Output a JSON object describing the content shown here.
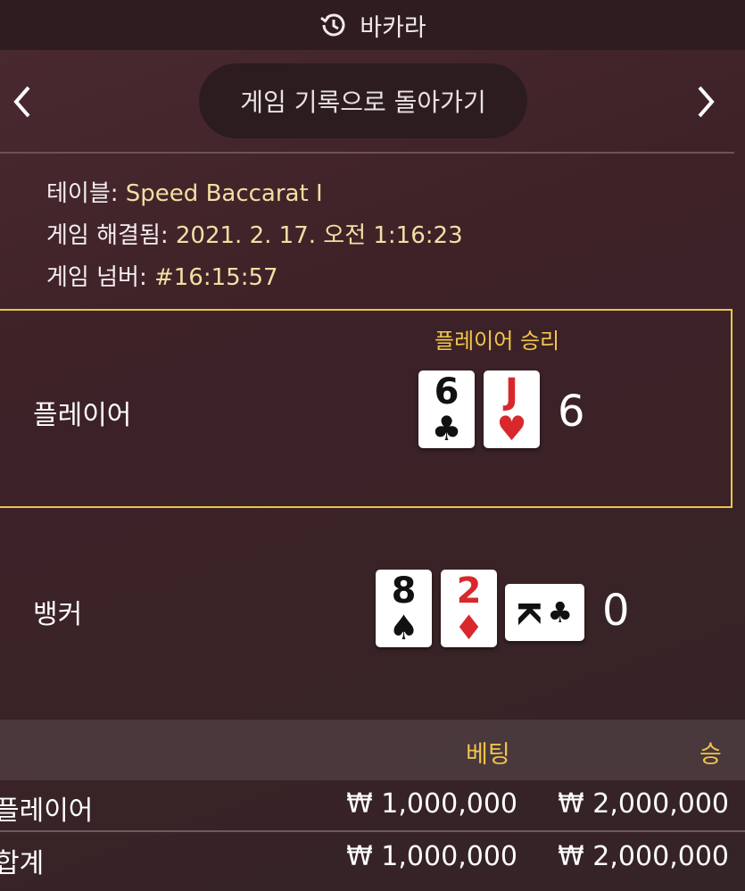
{
  "header": {
    "title": "바카라",
    "icon": "history-icon"
  },
  "nav": {
    "back_label": "게임 기록으로 돌아가기",
    "prev_icon": "chevron-left-icon",
    "next_icon": "chevron-right-icon"
  },
  "info": {
    "table_label": "테이블: ",
    "table_value": "Speed Baccarat I",
    "resolved_label": "게임 해결됨: ",
    "resolved_value": "2021. 2. 17. 오전 1:16:23",
    "number_label": "게임 넘버: ",
    "number_value": "#16:15:57"
  },
  "player": {
    "label": "플레이어",
    "result": "플레이어 승리",
    "score": "6",
    "cards": [
      {
        "rank": "6",
        "suit": "♣",
        "color": "black"
      },
      {
        "rank": "J",
        "suit": "♥",
        "color": "red"
      }
    ]
  },
  "banker": {
    "label": "뱅커",
    "score": "0",
    "cards": [
      {
        "rank": "8",
        "suit": "♠",
        "color": "black"
      },
      {
        "rank": "2",
        "suit": "♦",
        "color": "red"
      },
      {
        "rank": "K",
        "suit": "♣",
        "color": "black"
      }
    ]
  },
  "bets_table": {
    "headers": {
      "bet": "베팅",
      "win": "승"
    },
    "rows": [
      {
        "label": "플레이어",
        "bet": "₩ 1,000,000",
        "win": "₩ 2,000,000"
      },
      {
        "label": "합계",
        "bet": "₩ 1,000,000",
        "win": "₩ 2,000,000"
      }
    ]
  },
  "colors": {
    "accent": "#f2c84a",
    "info_value": "#f3dfa4",
    "card_red": "#d8282c"
  }
}
